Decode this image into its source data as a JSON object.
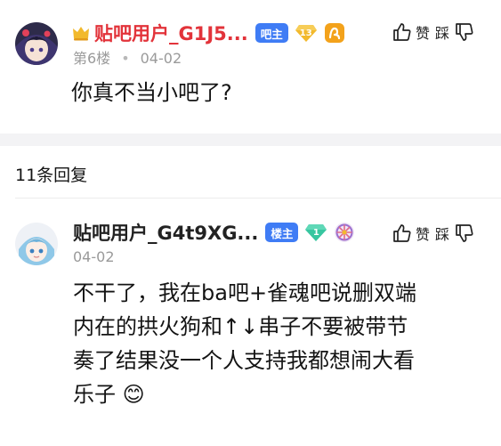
{
  "post": {
    "username": "贴吧用户_G1J5...",
    "role_badge": "吧主",
    "level": "13",
    "floor": "第6楼",
    "date": "04-02",
    "content": "你真不当小吧了?",
    "like_label": "赞",
    "dislike_label": "踩"
  },
  "reply_header": "11条回复",
  "reply": {
    "username": "贴吧用户_G4t9XG...",
    "role_badge": "楼主",
    "level": "1",
    "date": "04-02",
    "content_lines": [
      "不干了，我在ba吧+雀魂吧说删双端",
      "内在的拱火狗和↑↓串子不要被带节",
      "奏了结果没一个人支持我都想闹大看",
      "乐子"
    ],
    "emoji": "😊",
    "like_label": "赞",
    "dislike_label": "踩"
  },
  "colors": {
    "owner_name": "#e2333a",
    "badge_blue": "#3f7cf5",
    "level_gold": "#f2b92c",
    "level_green": "#37c6a0",
    "meta_gray": "#9a9a9a"
  },
  "icons": [
    "crown-icon",
    "level-gem-icon",
    "vip-icon",
    "thumb-up-icon",
    "thumb-down-icon",
    "wheel-icon"
  ]
}
